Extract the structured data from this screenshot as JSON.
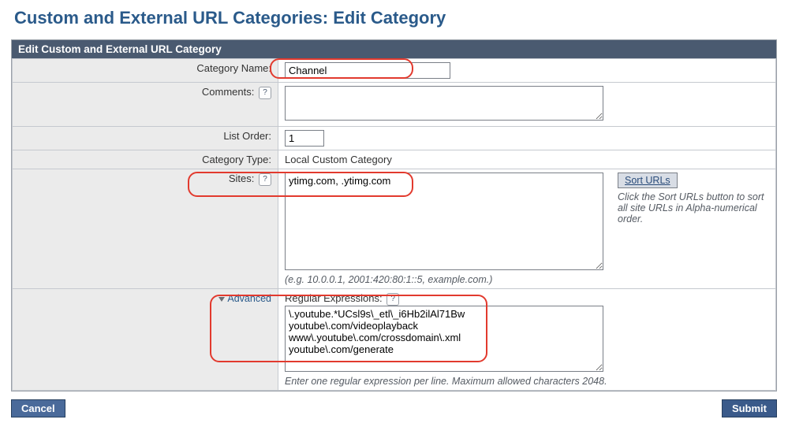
{
  "page_title": "Custom and External URL Categories: Edit Category",
  "panel_header": "Edit Custom and External URL Category",
  "labels": {
    "category_name": "Category Name:",
    "comments": "Comments:",
    "list_order": "List Order:",
    "category_type": "Category Type:",
    "sites": "Sites:",
    "advanced": "Advanced",
    "regex_header": "Regular Expressions:"
  },
  "values": {
    "category_name": "Channel",
    "comments": "",
    "list_order": "1",
    "category_type": "Local Custom Category",
    "sites": "ytimg.com, .ytimg.com",
    "sites_hint": "(e.g. 10.0.0.1, 2001:420:80:1::5, example.com.)",
    "regex": "\\.youtube.*UCsl9s\\_etl\\_i6Hb2ilAl71Bw\nyoutube\\.com/videoplayback\nwww\\.youtube\\.com/crossdomain\\.xml\nyoutube\\.com/generate",
    "regex_hint": "Enter one regular expression per line. Maximum allowed characters 2048."
  },
  "sort": {
    "button": "Sort URLs",
    "hint": "Click the Sort URLs button to sort all site URLs in Alpha-numerical order."
  },
  "buttons": {
    "cancel": "Cancel",
    "submit": "Submit"
  }
}
